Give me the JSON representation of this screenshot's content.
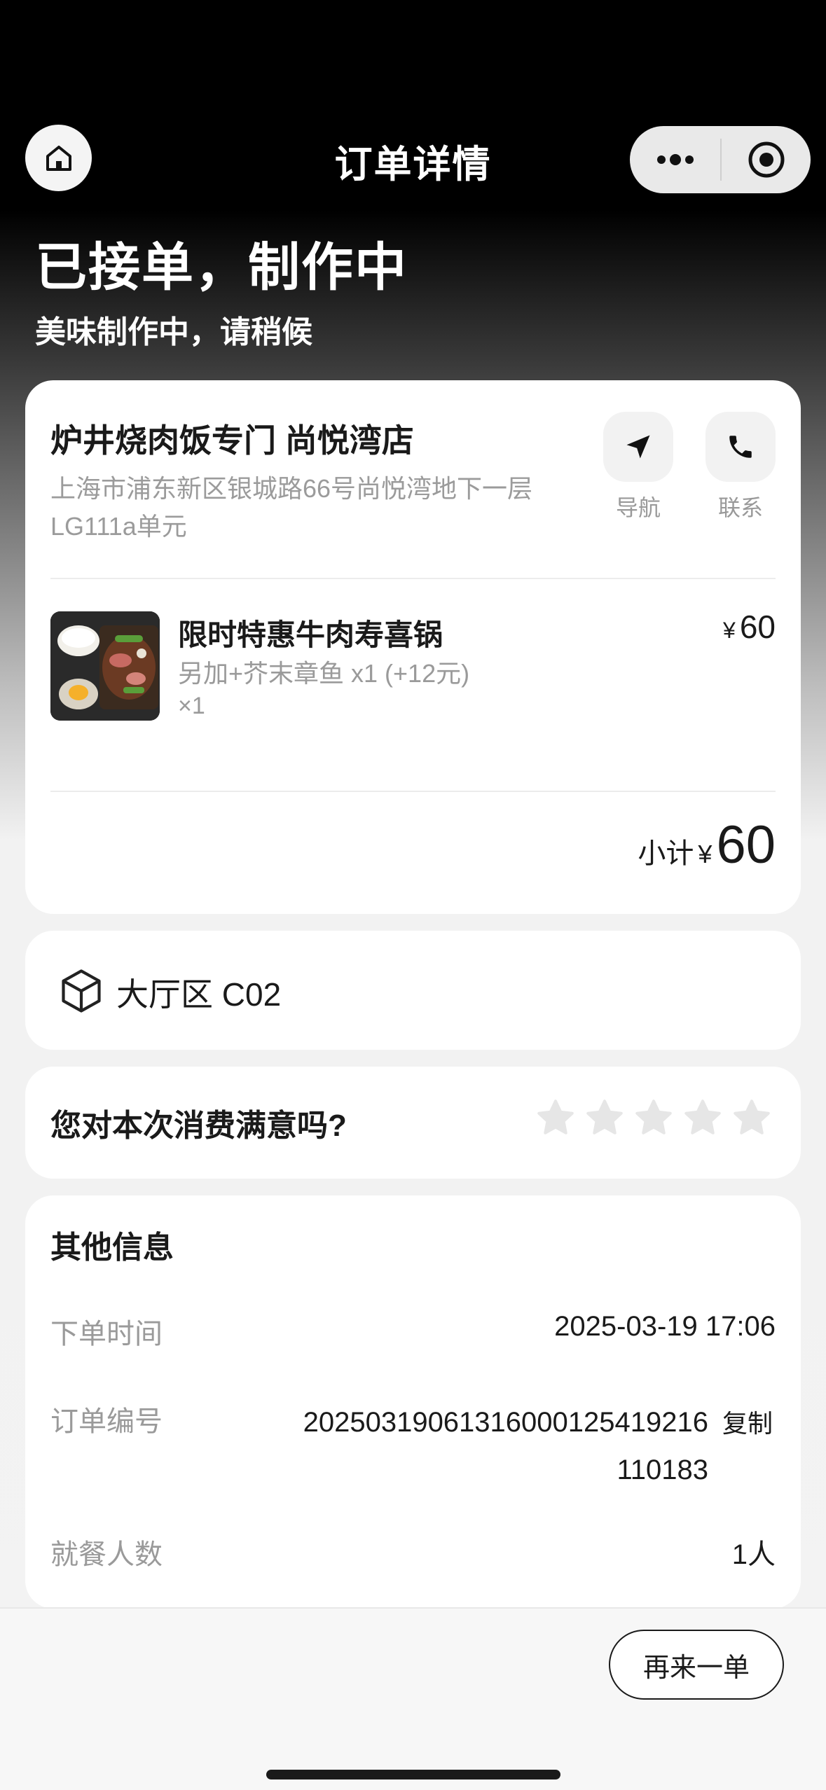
{
  "nav": {
    "title": "订单详情"
  },
  "status": {
    "title": "已接单，制作中",
    "subtitle": "美味制作中，请稍候"
  },
  "store": {
    "name": "炉井烧肉饭专门 尚悦湾店",
    "address": "上海市浦东新区银城路66号尚悦湾地下一层LG111a单元",
    "navigate_label": "导航",
    "contact_label": "联系"
  },
  "item": {
    "name": "限时特惠牛肉寿喜锅",
    "spec": "另加+芥末章鱼 x1 (+12元)",
    "qty": "×1",
    "currency": "¥",
    "price": "60"
  },
  "subtotal": {
    "label": "小计",
    "currency": "¥",
    "amount": "60"
  },
  "table": {
    "text": "大厅区 C02"
  },
  "rating": {
    "question": "您对本次消费满意吗?",
    "stars": 0,
    "max_stars": 5
  },
  "info": {
    "title": "其他信息",
    "order_time_label": "下单时间",
    "order_time": "2025-03-19 17:06",
    "order_no_label": "订单编号",
    "order_no": "20250319061316000125419216110183",
    "copy_label": "复制",
    "diners_label": "就餐人数",
    "diners": "1人"
  },
  "footer": {
    "reorder_label": "再来一单"
  },
  "colors": {
    "accent": "#1a1a1a",
    "muted": "#9a9a9a",
    "star": "#e6e6e6"
  },
  "icons": [
    "home-icon",
    "more-icon",
    "close-miniprogram-icon",
    "navigation-arrow-icon",
    "phone-icon",
    "table-box-icon",
    "star-icon"
  ]
}
